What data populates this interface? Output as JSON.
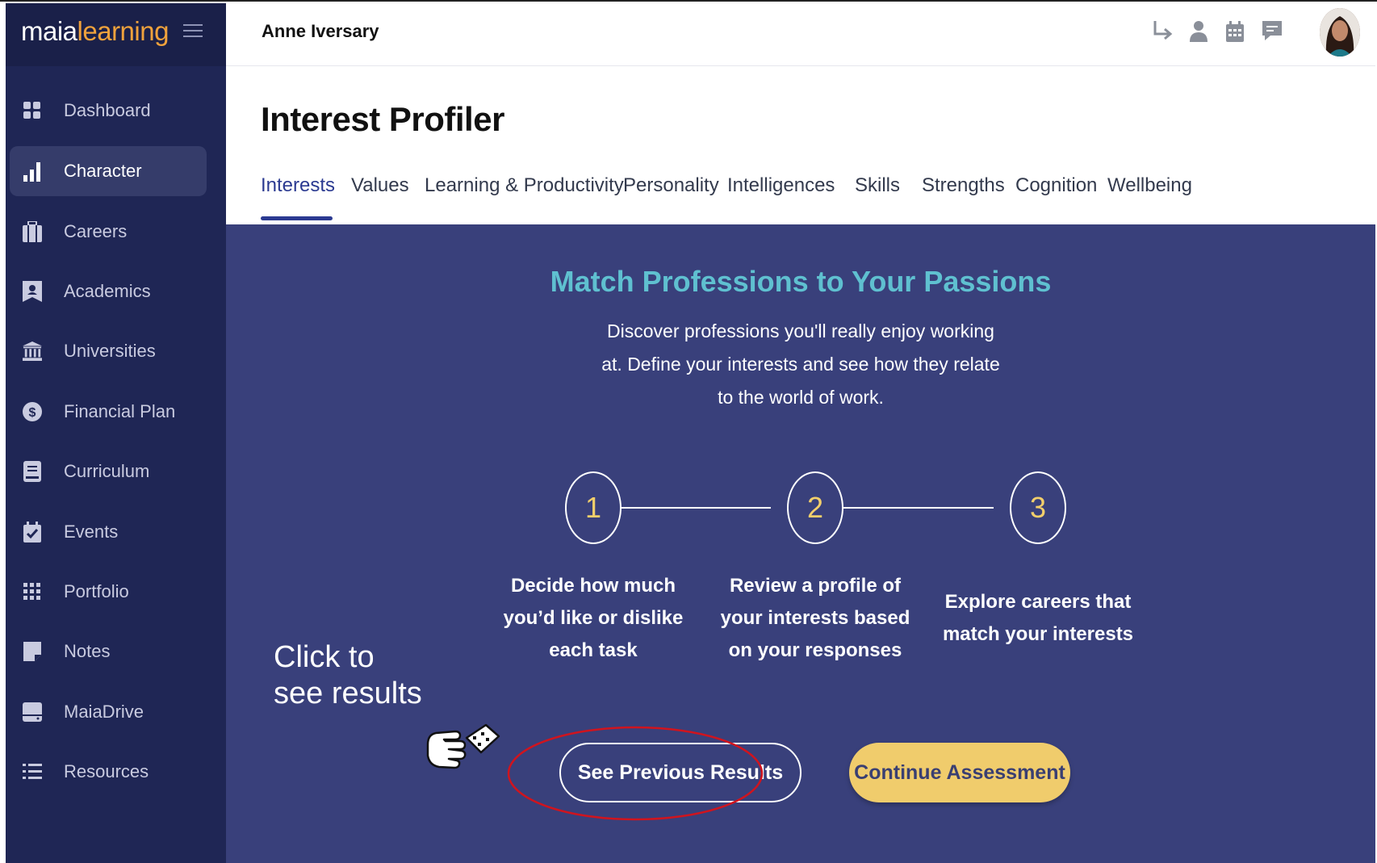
{
  "app": {
    "logo_primary": "maia",
    "logo_accent": "learning",
    "brand_accent_color": "#f0a23c"
  },
  "sidebar": {
    "items": [
      {
        "label": "Dashboard",
        "icon": "dashboard-icon",
        "active": false
      },
      {
        "label": "Character",
        "icon": "bar-chart-icon",
        "active": true
      },
      {
        "label": "Careers",
        "icon": "briefcase-icon",
        "active": false
      },
      {
        "label": "Academics",
        "icon": "academics-icon",
        "active": false
      },
      {
        "label": "Universities",
        "icon": "university-icon",
        "active": false
      },
      {
        "label": "Financial Plan",
        "icon": "dollar-icon",
        "active": false
      },
      {
        "label": "Curriculum",
        "icon": "book-icon",
        "active": false
      },
      {
        "label": "Events",
        "icon": "calendar-check-icon",
        "active": false
      },
      {
        "label": "Portfolio",
        "icon": "grid-dots-icon",
        "active": false
      },
      {
        "label": "Notes",
        "icon": "note-icon",
        "active": false
      },
      {
        "label": "MaiaDrive",
        "icon": "drive-icon",
        "active": false
      },
      {
        "label": "Resources",
        "icon": "list-icon",
        "active": false
      }
    ]
  },
  "topbar": {
    "user_name": "Anne Iversary",
    "icons": [
      "redirect-arrow-icon",
      "person-icon",
      "calendar-icon",
      "message-icon",
      "avatar"
    ]
  },
  "header": {
    "title": "Interest Profiler",
    "tabs": [
      {
        "label": "Interests",
        "active": true
      },
      {
        "label": "Values",
        "active": false
      },
      {
        "label": "Learning & Productivity",
        "active": false
      },
      {
        "label": "Personality",
        "active": false
      },
      {
        "label": "Intelligences",
        "active": false
      },
      {
        "label": "Skills",
        "active": false
      },
      {
        "label": "Strengths",
        "active": false
      },
      {
        "label": "Cognition",
        "active": false
      },
      {
        "label": "Wellbeing",
        "active": false
      }
    ]
  },
  "main": {
    "headline": "Match Professions to Your Passions",
    "intro_lines": [
      "Discover professions you'll really enjoy working",
      "at. Define your interests and see how they relate",
      "to the world of work."
    ],
    "steps": [
      {
        "number": "1",
        "lines": [
          "Decide how much",
          "you’d like or dislike",
          "each task"
        ]
      },
      {
        "number": "2",
        "lines": [
          "Review a profile of",
          "your interests based",
          "on your responses"
        ]
      },
      {
        "number": "3",
        "lines": [
          "Explore careers that",
          "match your interests"
        ]
      }
    ],
    "annotation_lines": [
      "Click to",
      "see results"
    ],
    "see_previous_label": "See Previous Results",
    "continue_label": "Continue Assessment",
    "colors": {
      "panel_bg": "#39407b",
      "headline": "#5fc0d0",
      "step_number": "#f3cf6b",
      "continue_bg": "#f0cc6c",
      "highlight_ellipse": "#d0141e"
    }
  }
}
